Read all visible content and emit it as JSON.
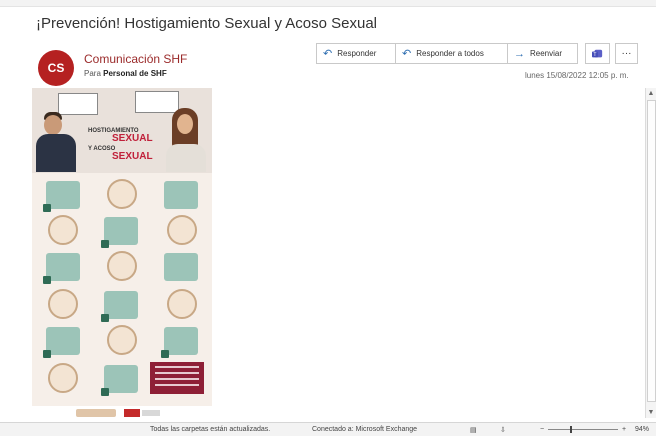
{
  "email": {
    "subject": "¡Prevención! Hostigamiento Sexual y Acoso Sexual",
    "sender_initials": "CS",
    "sender_name": "Comunicación SHF",
    "to_label": "Para",
    "to_value": "Personal de SHF",
    "timestamp": "lunes 15/08/2022 12:05 p. m."
  },
  "actions": {
    "reply": "Responder",
    "reply_all": "Responder a todos",
    "forward": "Reenviar",
    "teams_icon": "teams-icon",
    "more": "···"
  },
  "poster": {
    "title_line1": "HOSTIGAMIENTO",
    "title_line2": "SEXUAL",
    "title_line3": "Y ACOSO",
    "title_line4": "SEXUAL"
  },
  "statusbar": {
    "folders_status": "Todas las carpetas están actualizadas.",
    "connection": "Conectado a: Microsoft Exchange",
    "zoom": "94%"
  },
  "colors": {
    "avatar": "#b52121",
    "sender_name": "#9b2b2b",
    "link_blue": "#2b6cb0",
    "poster_red": "#c0203a",
    "tile_green": "#9cc4b8"
  }
}
